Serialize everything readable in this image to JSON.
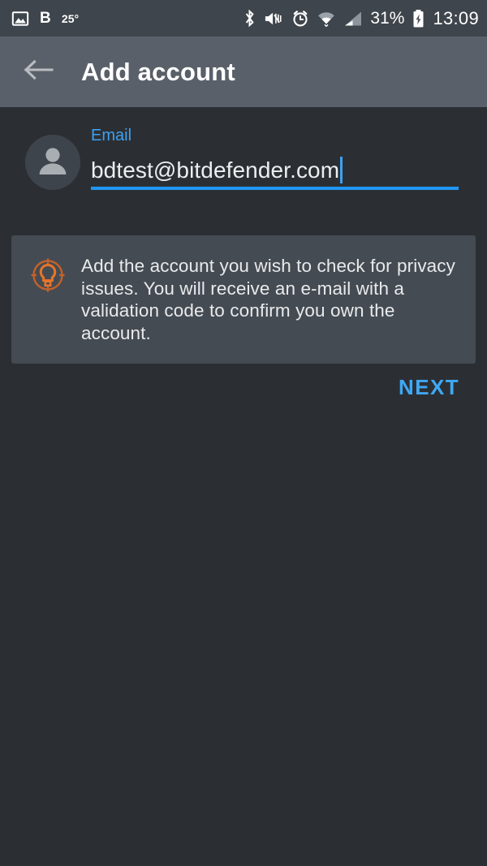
{
  "status_bar": {
    "left_icons": [
      {
        "name": "image-icon",
        "label": ""
      },
      {
        "name": "letter-b-icon",
        "label": "B"
      }
    ],
    "temperature": "25°",
    "right_icons": [
      {
        "name": "bluetooth-icon"
      },
      {
        "name": "volume-mute-vibrate-icon"
      },
      {
        "name": "alarm-clock-icon"
      },
      {
        "name": "wifi-icon"
      },
      {
        "name": "cellular-signal-icon"
      }
    ],
    "battery_percent": "31%",
    "battery_state_icon": "battery-charging-icon",
    "clock": "13:09"
  },
  "toolbar": {
    "back_icon": "arrow-back-icon",
    "title": "Add account"
  },
  "form": {
    "avatar_icon": "account-avatar-icon",
    "email_label": "Email",
    "email_value": "bdtest@bitdefender.com",
    "email_placeholder": "Email",
    "accent_color": "#2196F3",
    "label_color": "#3fa0f0"
  },
  "info_card": {
    "icon": "lightbulb-tip-icon",
    "icon_color": "#E8742A",
    "text": "Add the account you wish to check for privacy issues. You will receive an e-mail with a validation code to confirm you own the account."
  },
  "actions": {
    "next_label": "NEXT",
    "next_color": "#3fa8f5"
  },
  "theme": {
    "background": "#2b2f34",
    "toolbar_background": "#5a6069",
    "statusbar_background": "#3f454c",
    "card_background": "#454b52"
  }
}
